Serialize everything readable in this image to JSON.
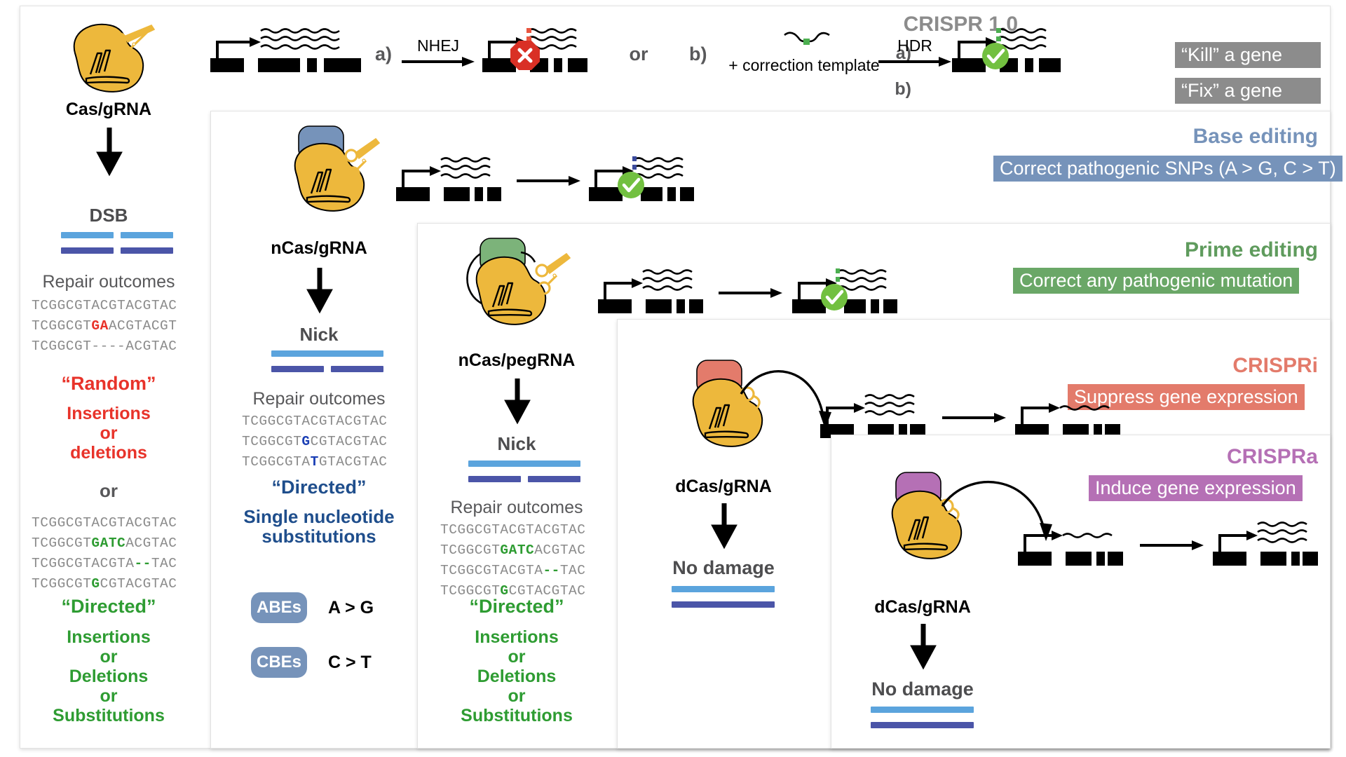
{
  "panels": {
    "crispr1": {
      "title": "CRISPR 1.0",
      "item_a_marker": "a)",
      "item_a": "“Kill” a gene",
      "item_b_marker": "b)",
      "item_b": "“Fix” a gene",
      "effector_label": "Cas/gRNA",
      "break_label": "DSB",
      "repair_label": "Repair outcomes",
      "branch_a_marker": "a)",
      "branch_a_pathway": "NHEJ",
      "conjunction": "or",
      "branch_b_marker": "b)",
      "branch_b_template": "+ correction template",
      "branch_b_pathway": "HDR",
      "outcomes_random": [
        {
          "pre": "TCGGCGTACGTACGTAC",
          "hl": "",
          "post": "",
          "color": ""
        },
        {
          "pre": "TCGGCGT",
          "hl": "GA",
          "post": "ACGTACGT",
          "color": "r"
        },
        {
          "pre": "TCGGCGT----ACGTAC",
          "hl": "",
          "post": "",
          "color": ""
        }
      ],
      "random_caption": "“Random”",
      "random_desc": [
        "Insertions",
        "or",
        "deletions"
      ],
      "divider_or": "or",
      "outcomes_directed": [
        {
          "pre": "TCGGCGTACGTACGTAC",
          "hl": "",
          "post": "",
          "color": ""
        },
        {
          "pre": "TCGGCGT",
          "hl": "GATC",
          "post": "ACGTAC",
          "color": "g"
        },
        {
          "pre": "TCGGCGTACGTA",
          "hl": "--",
          "post": "TAC",
          "color": "g"
        },
        {
          "pre": "TCGGCGT",
          "hl": "G",
          "post": "CGTACGTAC",
          "color": "g"
        }
      ],
      "directed_caption": "“Directed”",
      "directed_desc": [
        "Insertions",
        "or",
        "Deletions",
        "or",
        "Substitutions"
      ]
    },
    "base": {
      "title": "Base editing",
      "banner": "Correct pathogenic SNPs (A > G, C > T)",
      "effector_label": "nCas/gRNA",
      "break_label": "Nick",
      "repair_label": "Repair outcomes",
      "outcomes": [
        {
          "pre": "TCGGCGTACGTACGTAC",
          "hl": "",
          "post": "",
          "color": ""
        },
        {
          "pre": "TCGGCGT",
          "hl": "G",
          "post": "CGTACGTAC",
          "color": "b"
        },
        {
          "pre": "TCGGCGTA",
          "hl": "T",
          "post": "GTACGTAC",
          "color": "b"
        }
      ],
      "caption": "“Directed”",
      "desc": [
        "Single nucleotide",
        "substitutions"
      ],
      "editors": [
        {
          "badge": "ABEs",
          "conversion": "A > G"
        },
        {
          "badge": "CBEs",
          "conversion": "C > T"
        }
      ]
    },
    "prime": {
      "title": "Prime editing",
      "banner": "Correct any pathogenic mutation",
      "effector_label": "nCas/pegRNA",
      "break_label": "Nick",
      "repair_label": "Repair outcomes",
      "outcomes": [
        {
          "pre": "TCGGCGTACGTACGTAC",
          "hl": "",
          "post": "",
          "color": ""
        },
        {
          "pre": "TCGGCGT",
          "hl": "GATC",
          "post": "ACGTAC",
          "color": "g"
        },
        {
          "pre": "TCGGCGTACGTA",
          "hl": "--",
          "post": "TAC",
          "color": "g"
        },
        {
          "pre": "TCGGCGT",
          "hl": "G",
          "post": "CGTACGTAC",
          "color": "g"
        }
      ],
      "caption": "“Directed”",
      "desc": [
        "Insertions",
        "or",
        "Deletions",
        "or",
        "Substitutions"
      ]
    },
    "crispri": {
      "title": "CRISPRi",
      "banner": "Suppress gene expression",
      "effector_label": "dCas/gRNA",
      "result_label": "No damage"
    },
    "crispra": {
      "title": "CRISPRa",
      "banner": "Induce gene expression",
      "effector_label": "dCas/gRNA",
      "result_label": "No damage"
    }
  },
  "colors": {
    "cas_yellow": "#edb83c",
    "base_blue": "#7693ba",
    "prime_green": "#7cb37a",
    "crispri_salmon": "#e37b6b",
    "crispra_purple": "#b570b5",
    "gray_tag": "#8c8c8c",
    "dna_top": "#5ba4dd",
    "dna_bottom": "#4b55a8",
    "red_text": "#e8332a",
    "green_text": "#2e9c32",
    "blue_text": "#1b3fb5",
    "stop_red": "#d93025",
    "ok_green": "#72c040"
  }
}
